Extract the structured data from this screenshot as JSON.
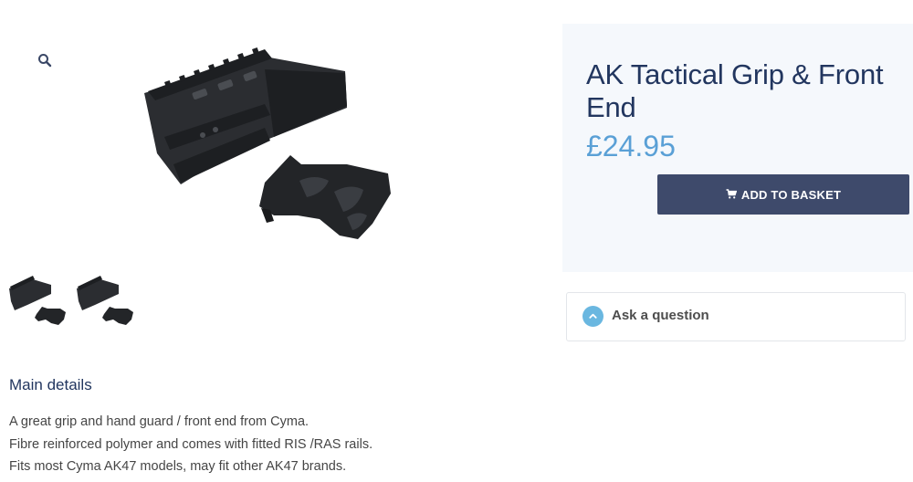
{
  "gallery": {
    "zoom_icon": "magnifier-icon",
    "thumbnail_count": 2
  },
  "product": {
    "title": "AK Tactical Grip & Front End",
    "price": "£24.95",
    "add_to_basket_label": "ADD TO BASKET",
    "cart_icon": "cart-icon"
  },
  "ask": {
    "label": "Ask a question",
    "icon": "chevron-up-icon"
  },
  "details": {
    "heading": "Main details",
    "lines": [
      "A great grip and hand guard / front end from Cyma.",
      "Fibre reinforced polymer and comes with fitted RIS /RAS rails.",
      "Fits most Cyma AK47 models, may fit other AK47 brands."
    ]
  },
  "colors": {
    "title": "#22365f",
    "price": "#5aa0d6",
    "button": "#3e4a6b",
    "panel_bg": "#f5f8fc",
    "ask_icon": "#6ab7e0"
  }
}
